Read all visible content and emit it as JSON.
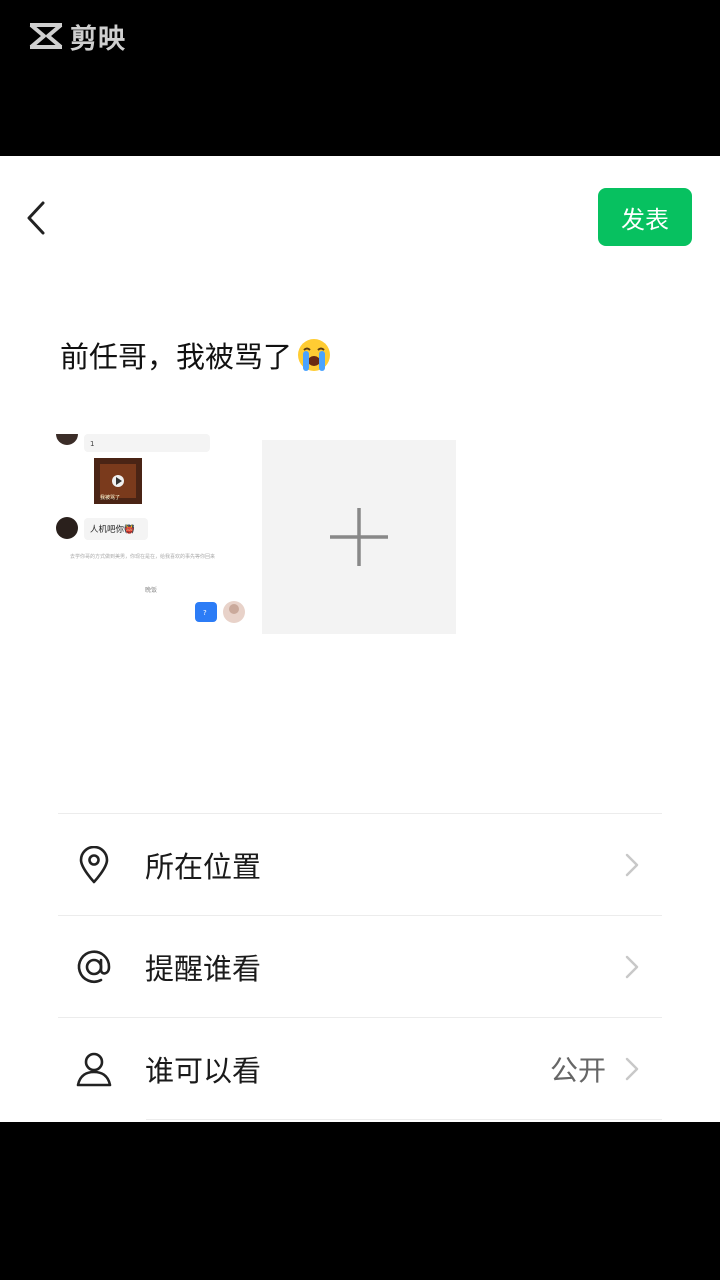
{
  "watermark": {
    "brand": "剪映"
  },
  "header": {
    "publish_label": "发表"
  },
  "post": {
    "text": "前任哥，我被骂了",
    "emoji": "loudly-crying-face-emoji"
  },
  "thumbnail_chat": {
    "first_msg": "1",
    "video_caption": "我被骂了",
    "reply_msg": "人机吧你👹",
    "system_notice": "去学你哥的方式做到美男，你现在是在，给我喜欢的事先等你回来",
    "time_label": "晚饭",
    "my_msg": "?"
  },
  "menu": {
    "items": [
      {
        "label": "所在位置",
        "icon": "location-pin-icon"
      },
      {
        "label": "提醒谁看",
        "icon": "at-sign-icon"
      },
      {
        "label": "谁可以看",
        "value": "公开",
        "icon": "person-icon"
      }
    ]
  },
  "colors": {
    "accent": "#07c160"
  }
}
